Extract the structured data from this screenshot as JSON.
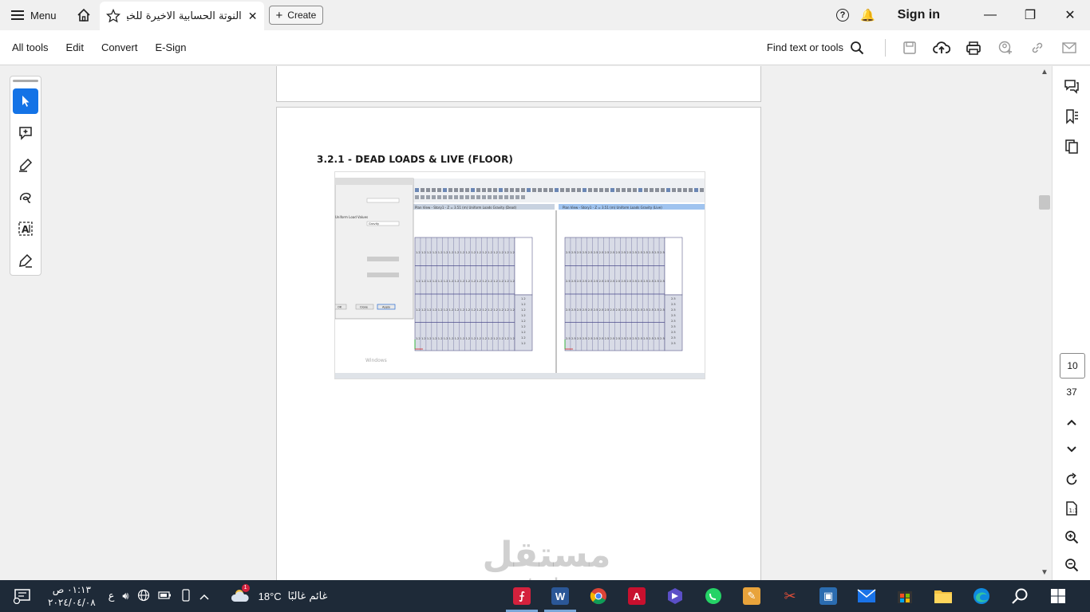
{
  "tabbar": {
    "menu_label": "Menu",
    "tab_title": "النوتة الحسابية الاخيرة للخيمة...",
    "create_label": "Create",
    "signin_label": "Sign in"
  },
  "toolbar": {
    "items": [
      "All tools",
      "Edit",
      "Convert",
      "E-Sign"
    ],
    "find_label": "Find text or tools"
  },
  "document": {
    "heading": "3.2.1 - DEAD LOADS & LIVE (FLOOR)"
  },
  "screenshot": {
    "panel_left_title": "Plan View - Story1 - Z = 3.51 (m)  Uniform Loads Gravity  (Dead)",
    "panel_right_title": "Plan View - Story1 - Z = 3.51 (m)  Uniform Loads Gravity  (Live)",
    "dead_value": "1.2",
    "live_value": "2.5",
    "dialog_buttons": [
      "OK",
      "Close",
      "Apply"
    ],
    "dialog_field": "Gravity",
    "dialog_label": "Uniform Load Values",
    "activate_windows": "Windows"
  },
  "navigation": {
    "current_page": "10",
    "total_pages": "37"
  },
  "watermark": {
    "arabic": "مستقل",
    "latin": "mostaql.com"
  },
  "taskbar": {
    "time": "٠١:١٣ ص",
    "date": "٢٠٢٤/٠٤/٠٨",
    "lang": "ع",
    "temperature": "18°C",
    "weather": "غائم غالبًا",
    "weather_badge": "1"
  },
  "colors": {
    "accent": "#1473e6",
    "taskbar": "#1e2a38"
  }
}
